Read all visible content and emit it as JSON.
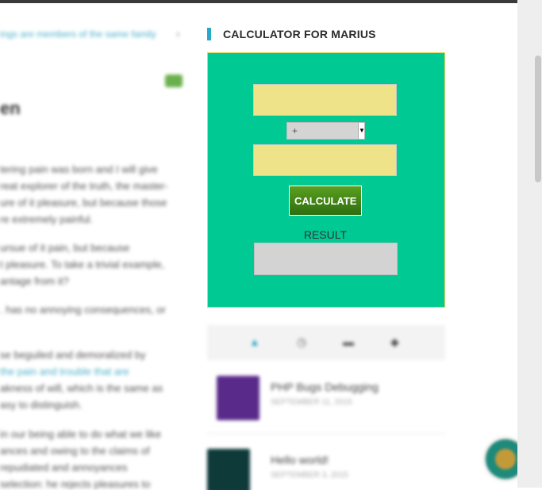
{
  "widget": {
    "title": "CALCULATOR FOR MARIUS",
    "operator_options": [
      "+"
    ],
    "operator_selected": "+",
    "calculate_label": "CALCULATE",
    "result_label": "RESULT",
    "first_value": "",
    "second_value": "",
    "result_value": ""
  },
  "article": {
    "breadcrumb": "ings are members of the same family",
    "heading": "en",
    "paragraphs": [
      "tering pain was born and I will give",
      "reat explorer of the truth, the master-",
      "ure of it pleasure, but because those",
      "re extremely painful.",
      "ursue of it pain, but because",
      "t pleasure. To take a trivial example,",
      "antage from it?",
      ". has no annoying consequences, or",
      "se beguiled and demoralized by",
      "the pain and trouble that are",
      "akness of will, which is the same as",
      "asy to distinguish.",
      "in our being able to do what we like",
      "ances and owing to the claims of",
      "repudiated and annoyances",
      "selection: he rejects pleasures to"
    ]
  },
  "tabs": {
    "icons": [
      "thumbs-up-icon",
      "clock-icon",
      "comment-icon",
      "tag-icon"
    ]
  },
  "posts": [
    {
      "title": "PHP Bugs Debugging",
      "date": "SEPTEMBER 11, 2015"
    },
    {
      "title": "Hello world!",
      "date": "SEPTEMBER 3, 2015"
    }
  ],
  "colors": {
    "calc_background": "#00c994",
    "input_background": "#efe38a",
    "button_green": "#4a8c1c",
    "title_accent": "#29a8c7",
    "result_background": "#d3d3d3"
  }
}
